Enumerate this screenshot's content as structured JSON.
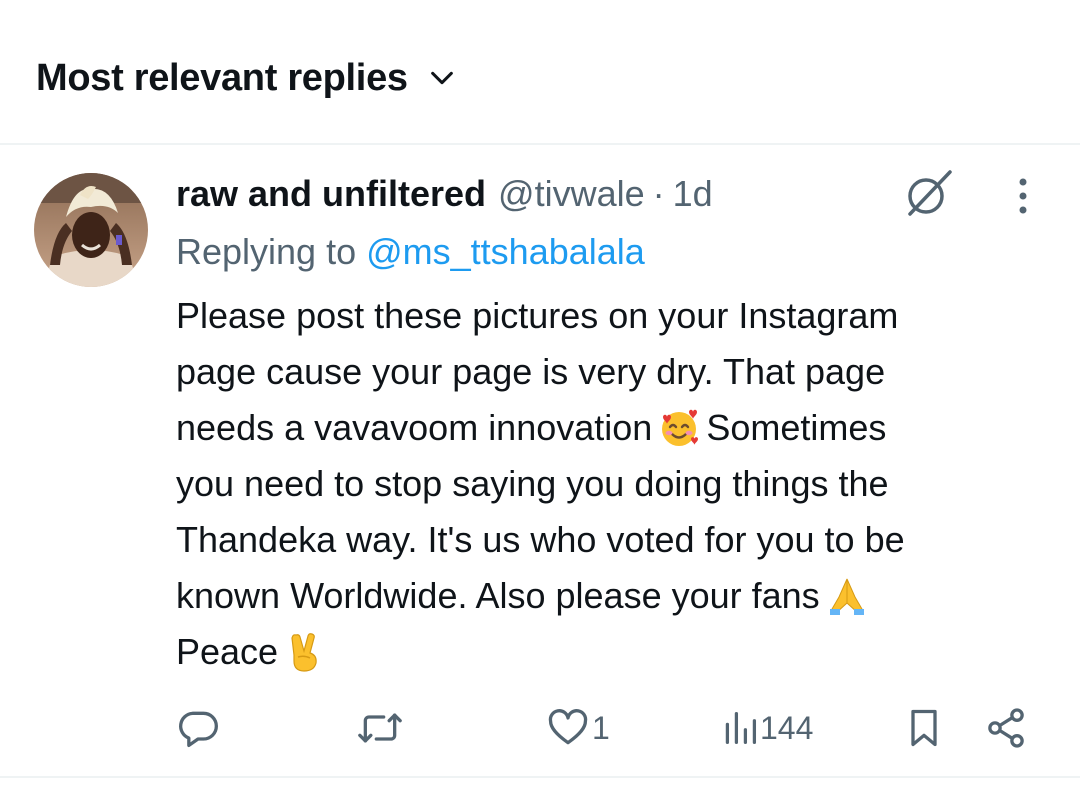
{
  "header": {
    "sort_label": "Most relevant replies",
    "chevron_icon": "chevron-down-icon"
  },
  "reply": {
    "display_name": "raw and unfiltered",
    "handle": "@tivwale",
    "separator": "·",
    "time": "1d",
    "replying_label": "Replying to",
    "replying_to": "@ms_ttshabalala",
    "lines": [
      "Please post these pictures on your Instagram",
      "page cause your page is very dry. That page",
      "needs a vavavoom innovation",
      "Sometimes",
      "you need to stop saying you doing things the",
      "Thandeka way. It's us who voted for you to be",
      "known Worldwide.  Also please your fans",
      "Peace"
    ],
    "emojis": [
      "smiling-face-with-hearts-emoji",
      "folded-hands-emoji",
      "victory-hand-emoji"
    ],
    "actions": {
      "reply_icon": "reply-icon",
      "repost_icon": "repost-icon",
      "like_icon": "heart-icon",
      "like_count": "1",
      "views_icon": "views-icon",
      "views_count": "144",
      "bookmark_icon": "bookmark-icon",
      "share_icon": "share-icon"
    },
    "top_right_icons": [
      "grok-icon",
      "more-icon"
    ]
  },
  "colors": {
    "text_primary": "#0f1419",
    "text_secondary": "#536471",
    "link": "#1d9bf0",
    "divider": "#eff3f4"
  }
}
